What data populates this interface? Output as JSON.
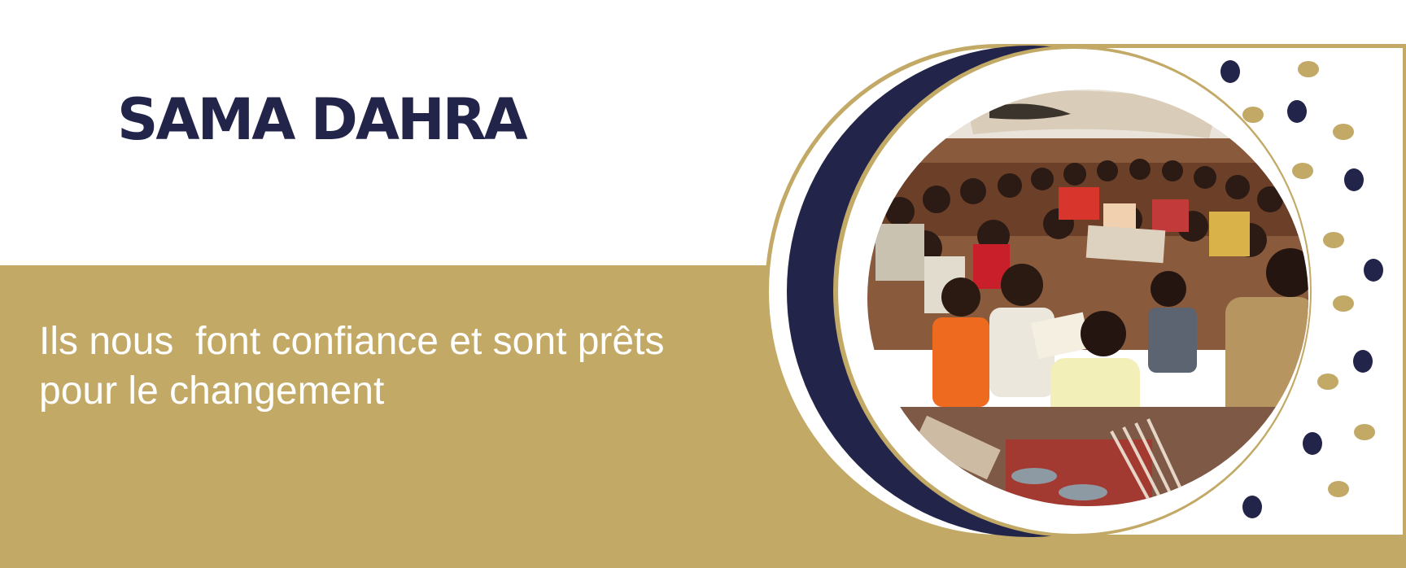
{
  "brand": {
    "title": "SAMA DAHRA"
  },
  "tagline": {
    "line1": "Ils nous  font confiance et sont prêts",
    "line2": "pour le changement"
  },
  "colors": {
    "navy": "#22244a",
    "gold": "#c2a966",
    "white": "#ffffff"
  },
  "illustration": {
    "subject": "children seated on mats holding wooden writing boards"
  },
  "icons": {
    "decoration": "dot-pattern-icon"
  }
}
